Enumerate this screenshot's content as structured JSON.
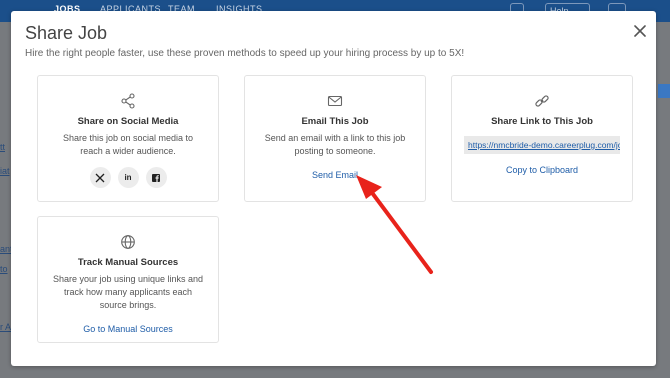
{
  "background": {
    "nav": [
      "JOBS",
      "APPLICANTS",
      "TEAM",
      "INSIGHTS"
    ],
    "help_label": "Help",
    "left_links": [
      "tt",
      "iat",
      "ant",
      "to",
      "r A"
    ]
  },
  "modal": {
    "title": "Share Job",
    "subtitle": "Hire the right people faster, use these proven methods to speed up your hiring process by up to 5X!",
    "close_icon": "close-icon"
  },
  "cards": {
    "social": {
      "icon": "share-icon",
      "title": "Share on Social Media",
      "description": "Share this job on social media to reach a wider audience.",
      "buttons": [
        {
          "name": "x",
          "icon": "x-icon"
        },
        {
          "name": "linkedin",
          "label": "in",
          "icon": "linkedin-icon"
        },
        {
          "name": "facebook",
          "icon": "facebook-icon"
        }
      ]
    },
    "email": {
      "icon": "envelope-icon",
      "title": "Email This Job",
      "description": "Send an email with a link to this job posting to someone.",
      "link_label": "Send Email"
    },
    "link": {
      "icon": "link-icon",
      "title": "Share Link to This Job",
      "url": "https://nmcbride-demo.careerplug.com/jo",
      "link_label": "Copy to Clipboard"
    },
    "manual": {
      "icon": "globe-icon",
      "title": "Track Manual Sources",
      "description": "Share your job using unique links and track how many applicants each source brings.",
      "link_label": "Go to Manual Sources"
    }
  },
  "colors": {
    "accent_link": "#1f5da8",
    "arrow": "#e8231b",
    "topbar": "#1b4f8a"
  }
}
